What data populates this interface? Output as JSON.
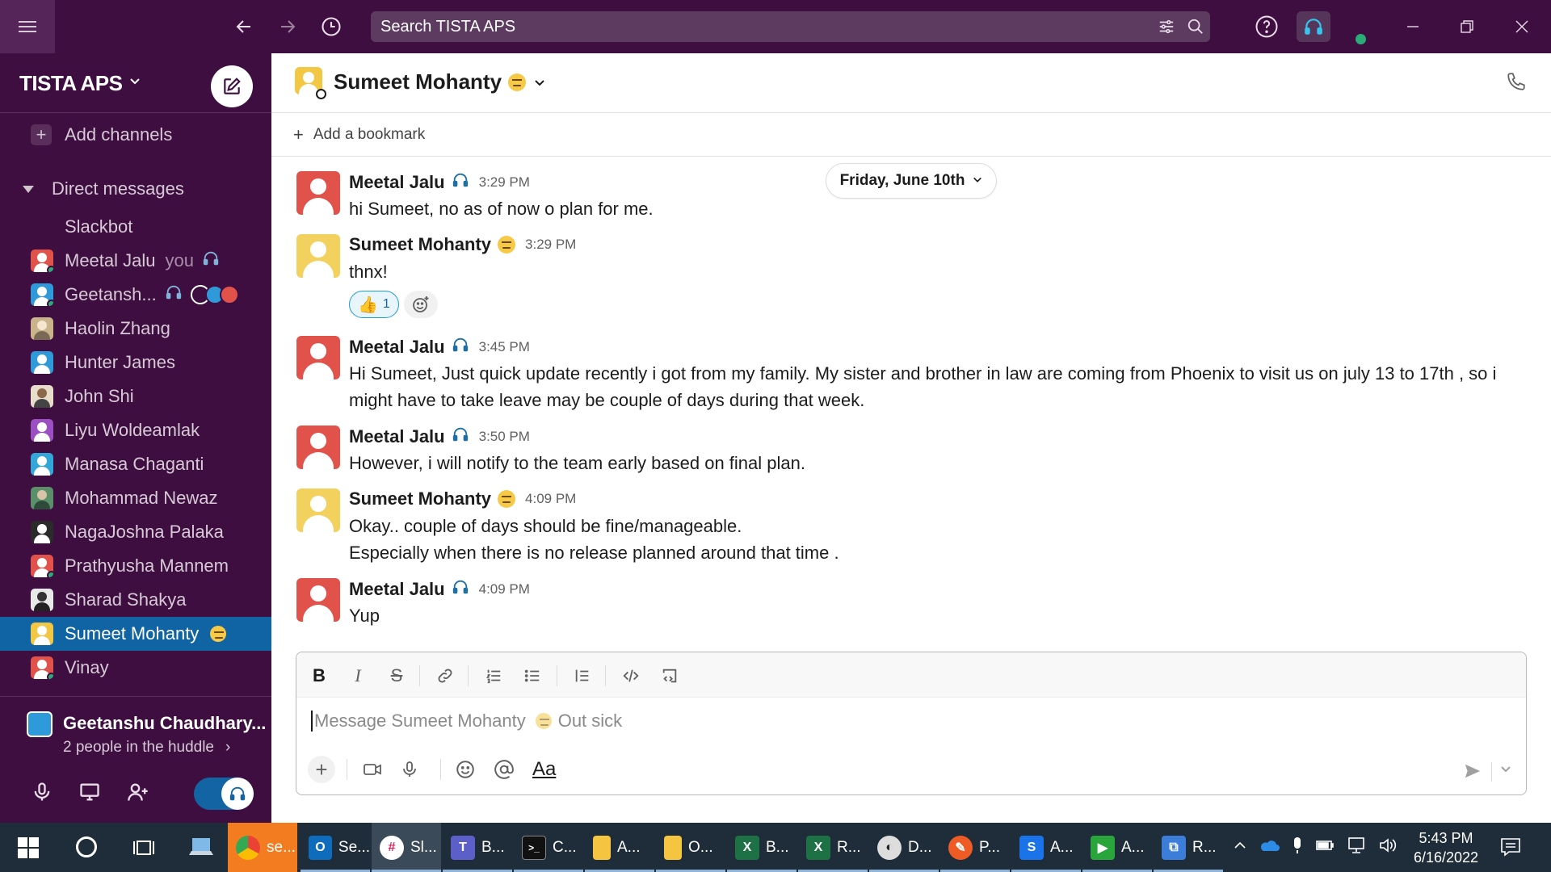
{
  "titlebar": {
    "search_placeholder": "Search TISTA APS"
  },
  "sidebar": {
    "workspace_name": "TISTA APS",
    "add_channels": "Add channels",
    "direct_messages_header": "Direct messages",
    "dms": [
      {
        "name": "Slackbot",
        "avatar_color": ""
      },
      {
        "name": "Meetal Jalu",
        "suffix": "you",
        "avatar_color": "#e0524a",
        "online": true
      },
      {
        "name": "Geetansh...",
        "avatar_color": "#2f9ad9",
        "online": true
      },
      {
        "name": "Haolin Zhang",
        "avatar_color": "#c9b38a"
      },
      {
        "name": "Hunter James",
        "avatar_color": "#2f9ad9"
      },
      {
        "name": "John Shi",
        "avatar_color": "#8a6a4a"
      },
      {
        "name": "Liyu Woldeamlak",
        "avatar_color": "#9c4fc2"
      },
      {
        "name": "Manasa Chaganti",
        "avatar_color": "#34a7d9"
      },
      {
        "name": "Mohammad Newaz",
        "avatar_color": "#5a8f6a"
      },
      {
        "name": "NagaJoshna Palaka",
        "avatar_color": "#2b2b2b"
      },
      {
        "name": "Prathyusha Mannem",
        "avatar_color": "#e0524a"
      },
      {
        "name": "Sharad Shakya",
        "avatar_color": "#3a3a3a"
      },
      {
        "name": "Sumeet Mohanty",
        "avatar_color": "#f2c744",
        "active": true
      },
      {
        "name": "Vinay",
        "avatar_color": "#e0524a"
      }
    ],
    "huddle": {
      "name": "Geetanshu Chaudhary...",
      "subtitle": "2 people in the huddle"
    }
  },
  "channel": {
    "title": "Sumeet Mohanty",
    "add_bookmark": "Add a bookmark",
    "date_divider": "Friday, June 10th"
  },
  "messages": [
    {
      "author": "Meetal Jalu",
      "time": "3:29 PM",
      "avatar_color": "#e0524a",
      "lines": [
        "hi Sumeet, no as of now o plan for me."
      ]
    },
    {
      "author": "Sumeet Mohanty",
      "time": "3:29 PM",
      "avatar_color": "#f2d15f",
      "lines": [
        "thnx!"
      ],
      "reaction_count": "1"
    },
    {
      "author": "Meetal Jalu",
      "time": "3:45 PM",
      "avatar_color": "#e0524a",
      "lines": [
        "Hi Sumeet, Just quick update recently i got from my family. My sister and brother in law are coming from Phoenix to visit us on july 13 to 17th , so i might have to take leave may be couple of days during that week."
      ]
    },
    {
      "author": "Meetal Jalu",
      "time": "3:50 PM",
      "avatar_color": "#e0524a",
      "lines": [
        "However, i will notify to the team early based on final plan."
      ]
    },
    {
      "author": "Sumeet Mohanty",
      "time": "4:09 PM",
      "avatar_color": "#f2d15f",
      "lines": [
        "Okay.. couple of days should be fine/manageable.",
        "Especially when there is no release planned around that time ."
      ]
    },
    {
      "author": "Meetal Jalu",
      "time": "4:09 PM",
      "avatar_color": "#e0524a",
      "lines": [
        "Yup"
      ]
    }
  ],
  "composer": {
    "placeholder": "Message Sumeet Mohanty",
    "status_text": "Out sick",
    "format_text_label": "Aa"
  },
  "taskbar": {
    "apps": [
      {
        "label": "se...",
        "icon": "chrome-icon",
        "color": "#f47c20"
      },
      {
        "label": "Se...",
        "icon": "outlook-icon",
        "color": "#0f6cbd"
      },
      {
        "label": "Sl...",
        "icon": "slack-icon",
        "color": "#ffffff"
      },
      {
        "label": "B...",
        "icon": "teams-icon",
        "color": "#5b5fc7"
      },
      {
        "label": "C...",
        "icon": "terminal-icon",
        "color": "#111111"
      },
      {
        "label": "A...",
        "icon": "folder-icon",
        "color": "#f5c542"
      },
      {
        "label": "O...",
        "icon": "folder-icon",
        "color": "#f5c542"
      },
      {
        "label": "B...",
        "icon": "excel-icon",
        "color": "#1e7145"
      },
      {
        "label": "R...",
        "icon": "excel-icon",
        "color": "#1e7145"
      },
      {
        "label": "D...",
        "icon": "app-icon",
        "color": "#dddddd"
      },
      {
        "label": "P...",
        "icon": "postman-icon",
        "color": "#ef5b25"
      },
      {
        "label": "A...",
        "icon": "azure-data-studio-icon",
        "color": "#1a73e8"
      },
      {
        "label": "A...",
        "icon": "media-icon",
        "color": "#2aa53c"
      },
      {
        "label": "R...",
        "icon": "remote-desktop-icon",
        "color": "#3b7dd8"
      }
    ],
    "time": "5:43 PM",
    "date": "6/16/2022"
  },
  "colors": {
    "sidebar_bg": "#3f0e40",
    "active_item": "#1164a3",
    "presence": "#2bac76"
  }
}
